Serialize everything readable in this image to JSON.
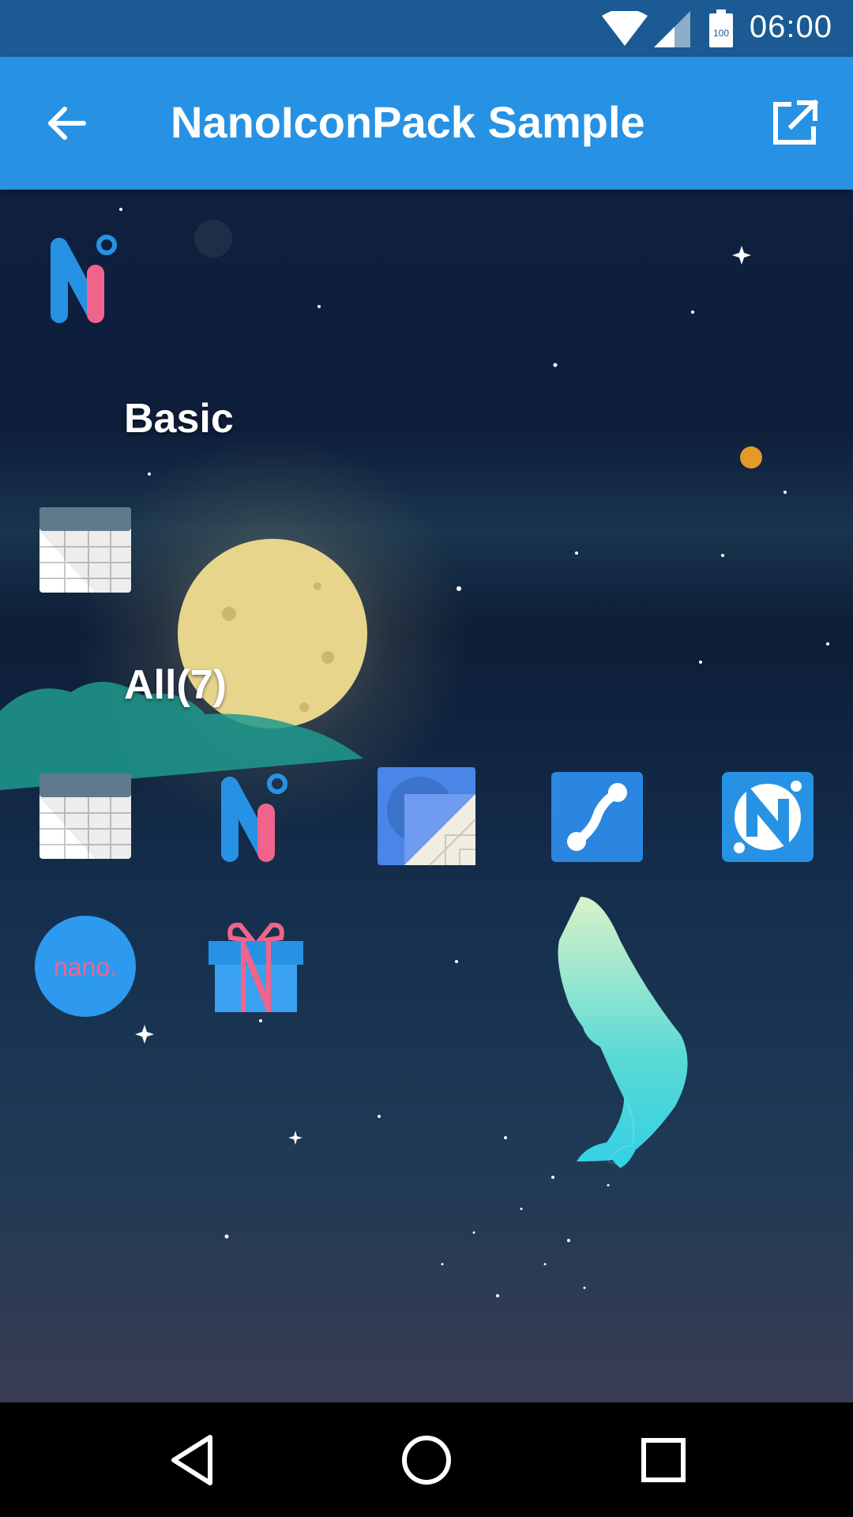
{
  "status_bar": {
    "time": "06:00",
    "battery_level": "100",
    "icons": [
      "wifi-icon",
      "cell-signal-icon",
      "battery-icon"
    ]
  },
  "app_bar": {
    "title": "NanoIconPack Sample",
    "back_icon": "back-arrow-icon",
    "action_icon": "open-external-icon"
  },
  "sections": {
    "basic_label": "Basic",
    "all_label": "All(7)"
  },
  "icons": {
    "basic": [
      "table-sheet-icon"
    ],
    "all": [
      "table-sheet-icon",
      "nano-n-icon",
      "material-square-icon",
      "link-path-icon",
      "nano-n-badge-icon",
      "nano-text-icon",
      "gift-box-icon"
    ],
    "nano_text": "nano."
  },
  "colors": {
    "status_bar": "#1b5a93",
    "app_bar": "#2792e4",
    "nav_bar": "#000000",
    "accent_pink": "#f0648c",
    "accent_blue": "#2792e4"
  },
  "nav_bar": {
    "icons": [
      "back-triangle-icon",
      "home-circle-icon",
      "recents-square-icon"
    ]
  }
}
